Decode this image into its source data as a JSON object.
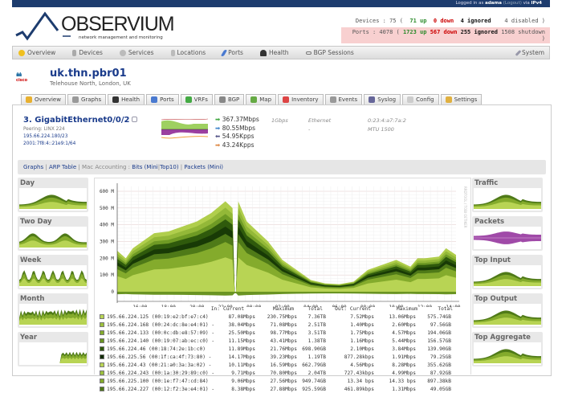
{
  "topbar": {
    "prefix": "Logged in as ",
    "user": "adama",
    "logout": "(Logout)",
    "via": " via ",
    "proto": "IPv4"
  },
  "logo": {
    "word": "OBSERVIUM",
    "tagline": "network management and monitoring"
  },
  "stats": {
    "devices_label": "Devices :",
    "devices_total": "75 (",
    "devices_up": "71 up",
    "devices_down": "0 down",
    "devices_ignored": "4 ignored",
    "devices_disabled": "4 disabled )",
    "ports_label": "Ports : 4078 (",
    "ports_up": "1723 up",
    "ports_down": "567 down",
    "ports_ignored": "255 ignored",
    "ports_shutdown": "1508 shutdown )"
  },
  "nav": {
    "items": [
      "Overview",
      "Devices",
      "Services",
      "Locations",
      "Ports",
      "Health",
      "BGP Sessions"
    ],
    "system": "System"
  },
  "device": {
    "vendor": "cisco",
    "name": "uk.thn.pbr01",
    "location": "Telehouse North, London, UK"
  },
  "tabs": [
    "Overview",
    "Graphs",
    "Health",
    "Ports",
    "VRFs",
    "BGP",
    "Map",
    "Inventory",
    "Events",
    "Syslog",
    "Config",
    "Settings"
  ],
  "port": {
    "name": "3. GigabitEthernet0/0/2",
    "descr": "Peering: LINX 224",
    "ipv4": "195.66.224.180/23",
    "ipv6": "2001:7f8:4::21e9:1/64",
    "in_bps": "367.37Mbps",
    "out_bps": "80.55Mbps",
    "in_pps": "54.95Kpps",
    "out_pps": "43.24Kpps",
    "speed": "1Gbps",
    "type": "Ethernet",
    "type2": "-",
    "mac": "0:23:4:a7:7a:2",
    "mtu": "MTU 1500"
  },
  "subnav": {
    "graphs": "Graphs",
    "arp": "ARP Table",
    "mac": "Mac Accounting :",
    "bits": "Bits",
    "mini": "Mini",
    "top10": "Top10",
    "packets": "Packets",
    "mini2": "Mini"
  },
  "left_thumbs": [
    "Day",
    "Two Day",
    "Week",
    "Month",
    "Year"
  ],
  "right_thumbs": [
    "Traffic",
    "Packets",
    "Top Input",
    "Top Output",
    "Top Aggregate"
  ],
  "chart_data": {
    "type": "area",
    "side_label": "RRDTOOL / TOBI OETIKER",
    "yticks": [
      "0",
      "100 M",
      "200 M",
      "300 M",
      "400 M",
      "500 M",
      "600 M"
    ],
    "ylim": [
      -30,
      600
    ],
    "xticks": [
      "16:00",
      "18:00",
      "20:00",
      "22:00",
      "00:00",
      "02:00",
      "04:00",
      "06:00",
      "08:00",
      "10:00",
      "12:00",
      "14:00"
    ],
    "x_hours": [
      14.4,
      15,
      15.5,
      16,
      17,
      18,
      19,
      20,
      21,
      22,
      22.5,
      22.65,
      22.75,
      22.9,
      23.5,
      24,
      25,
      26,
      27,
      28,
      29,
      30,
      31,
      32,
      33,
      34,
      35,
      35.5,
      36,
      37,
      37.5,
      38.2
    ],
    "total_in_mbps": [
      245,
      200,
      260,
      290,
      350,
      360,
      390,
      420,
      470,
      540,
      500,
      0,
      0,
      540,
      420,
      380,
      300,
      190,
      130,
      70,
      50,
      45,
      60,
      130,
      160,
      190,
      150,
      200,
      200,
      210,
      260,
      220
    ],
    "out_mbps": -15,
    "layer_colors": [
      "#b8d454",
      "#9cc03c",
      "#84ab2c",
      "#6a9422",
      "#4f7a18",
      "#2f5a0c",
      "#183a06",
      "#a8c848"
    ],
    "legend_headers": {
      "in": "In:",
      "out": "Out:",
      "current": "Current",
      "maximum": "Maximum",
      "total": "Total"
    },
    "rows": [
      {
        "name": "195.66.224.125 (00:19:e2:bf:e7:c4)  ",
        "in_cur": "87.08Mbps",
        "in_max": "230.75Mbps",
        "in_tot": "7.36TB",
        "out_cur": "7.52Mbps",
        "out_max": "13.06Mbps",
        "out_tot": "575.74GB",
        "color": "#b8d454"
      },
      {
        "name": "195.66.224.168 (00:24:dc:8e:e4:01) -",
        "in_cur": "38.04Mbps",
        "in_max": "71.08Mbps",
        "in_tot": "2.51TB",
        "out_cur": "1.40Mbps",
        "out_max": "2.60Mbps",
        "out_tot": "97.56GB",
        "color": "#9cc03c"
      },
      {
        "name": "195.66.224.133 (00:0c:db:e8:57:09) -",
        "in_cur": "25.50Mbps",
        "in_max": "98.77Mbps",
        "in_tot": "3.51TB",
        "out_cur": "1.75Mbps",
        "out_max": "4.57Mbps",
        "out_tot": "194.06GB",
        "color": "#84ab2c"
      },
      {
        "name": "195.66.224.140 (00:19:07:ab:ec:c0) -",
        "in_cur": "11.15Mbps",
        "in_max": "43.41Mbps",
        "in_tot": "1.38TB",
        "out_cur": "1.16Mbps",
        "out_max": "5.44Mbps",
        "out_tot": "156.57GB",
        "color": "#6a9422"
      },
      {
        "name": "195.66.224.46 (00:18:74:2e:1b:c0)  ",
        "in_cur": "11.89Mbps",
        "in_max": "21.76Mbps",
        "in_tot": "698.90GB",
        "out_cur": "2.10Mbps",
        "out_max": "3.84Mbps",
        "out_tot": "139.90GB",
        "color": "#2f5a0c"
      },
      {
        "name": "195.66.225.56 (00:1f:ca:4f:73:80) -",
        "in_cur": "14.17Mbps",
        "in_max": "39.23Mbps",
        "in_tot": "1.19TB",
        "out_cur": "877.28kbps",
        "out_max": "1.91Mbps",
        "out_tot": "79.25GB",
        "color": "#122c04"
      },
      {
        "name": "195.66.224.43 (00:21:a0:3a:3a:02) -",
        "in_cur": "10.11Mbps",
        "in_max": "16.59Mbps",
        "in_tot": "662.79GB",
        "out_cur": "4.56Mbps",
        "out_max": "8.28Mbps",
        "out_tot": "355.62GB",
        "color": "#b8d454"
      },
      {
        "name": "195.66.224.243 (00:1a:30:29:89:c0) -",
        "in_cur": "9.71Mbps",
        "in_max": "70.80Mbps",
        "in_tot": "2.04TB",
        "out_cur": "727.43kbps",
        "out_max": "4.99Mbps",
        "out_tot": "87.92GB",
        "color": "#9cc03c"
      },
      {
        "name": "195.66.225.100 (00:1e:f7:47:cd:84)  ",
        "in_cur": "9.06Mbps",
        "in_max": "27.56Mbps",
        "in_tot": "949.74GB",
        "out_cur": "13.34 bps",
        "out_max": "14.33 bps",
        "out_tot": "897.38kB",
        "color": "#84ab2c"
      },
      {
        "name": "195.66.224.227 (00:12:f2:3e:e4:01) -",
        "in_cur": "8.38Mbps",
        "in_max": "27.88Mbps",
        "in_tot": "925.59GB",
        "out_cur": "461.89kbps",
        "out_max": "1.31Mbps",
        "out_tot": "49.05GB",
        "color": "#4f7a18"
      }
    ]
  }
}
